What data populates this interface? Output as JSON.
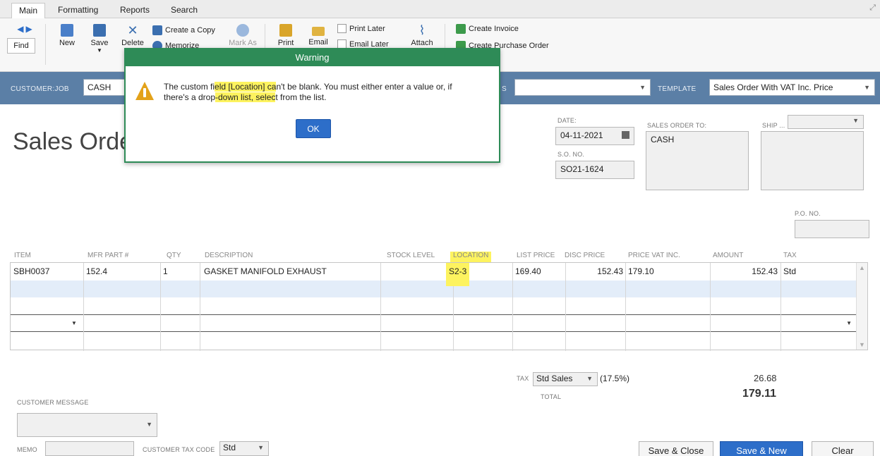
{
  "tabs": [
    "Main",
    "Formatting",
    "Reports",
    "Search"
  ],
  "toolbar": {
    "find": "Find",
    "new": "New",
    "save": "Save",
    "delete": "Delete",
    "create_copy": "Create a Copy",
    "memorize": "Memorize",
    "mark_as": "Mark As",
    "print": "Print",
    "email": "Email",
    "print_later": "Print Later",
    "email_later": "Email Later",
    "attach": "Attach",
    "create_invoice": "Create Invoice",
    "create_po": "Create Purchase Order"
  },
  "customer_bar": {
    "customer_job_label": "CUSTOMER:JOB",
    "customer_job_value": "CASH",
    "class_label_tail": "S",
    "template_label": "TEMPLATE",
    "template_value": "Sales Order With VAT Inc. Price"
  },
  "form": {
    "title": "Sales Order",
    "date_label": "DATE:",
    "date_value": "04-11-2021",
    "so_no_label": "S.O. NO.",
    "so_no_value": "SO21-1624",
    "sales_order_to_label": "SALES ORDER TO:",
    "sales_order_to_value": "CASH",
    "ship_label": "SHIP ...",
    "po_no_label": "P.O. NO."
  },
  "grid": {
    "headers": [
      "ITEM",
      "MFR PART #",
      "QTY",
      "DESCRIPTION",
      "STOCK LEVEL",
      "LOCATION",
      "LIST PRICE",
      "DISC PRICE",
      "PRICE VAT INC.",
      "AMOUNT",
      "TAX"
    ],
    "rows": [
      {
        "item": "SBH0037",
        "mfr": "152.4",
        "qty": "1",
        "desc": "GASKET MANIFOLD EXHAUST",
        "stock": "",
        "location": "S2-3",
        "list": "169.40",
        "disc": "152.43",
        "vat": "179.10",
        "amount": "152.43",
        "tax": "Std"
      }
    ]
  },
  "dialog": {
    "title": "Warning",
    "msg_a": "The custom fi",
    "msg_b": "eld [Location] ca",
    "msg_c": "n't be blank.  You must either enter a value or, if",
    "msg_d": "there's a drop",
    "msg_e": "-down list, selec",
    "msg_f": "t from the list.",
    "ok": "OK"
  },
  "totals": {
    "tax_label": "TAX",
    "tax_code": "Std Sales",
    "tax_rate": "(17.5%)",
    "tax_amount": "26.68",
    "total_label": "TOTAL",
    "total_value": "179.11"
  },
  "footer": {
    "customer_message_label": "CUSTOMER MESSAGE",
    "memo_label": "MEMO",
    "customer_tax_code_label": "CUSTOMER TAX CODE",
    "customer_tax_code_value": "Std",
    "save_close": "Save & Close",
    "save_new": "Save & New",
    "clear": "Clear"
  }
}
